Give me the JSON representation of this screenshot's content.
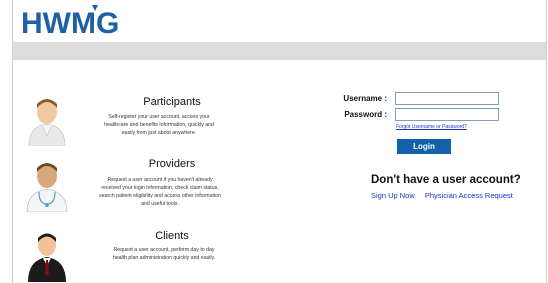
{
  "brand": {
    "logo_text": "HWMG",
    "accent": "#1f5fa3"
  },
  "participants": {
    "title": "Participants",
    "desc": "Self-register your user account, access your healthcare and benefits information, quickly and easily from just about anywhere."
  },
  "providers": {
    "title": "Providers",
    "desc": "Request a user account if you haven't already received your login information, check claim status, search patient eligibility and access other information and useful tools."
  },
  "clients": {
    "title": "Clients",
    "desc": "Request a user account, perform day to day health plan administration quickly and easily."
  },
  "login": {
    "username_label": "Username :",
    "password_label": "Password :",
    "username_value": "",
    "password_value": "",
    "forgot_link": "Forgot Username or Password?",
    "login_button": "Login"
  },
  "signup": {
    "heading": "Don't have a user account?",
    "sign_up_link": "Sign Up Now",
    "physician_link": "Physician Access Request"
  }
}
